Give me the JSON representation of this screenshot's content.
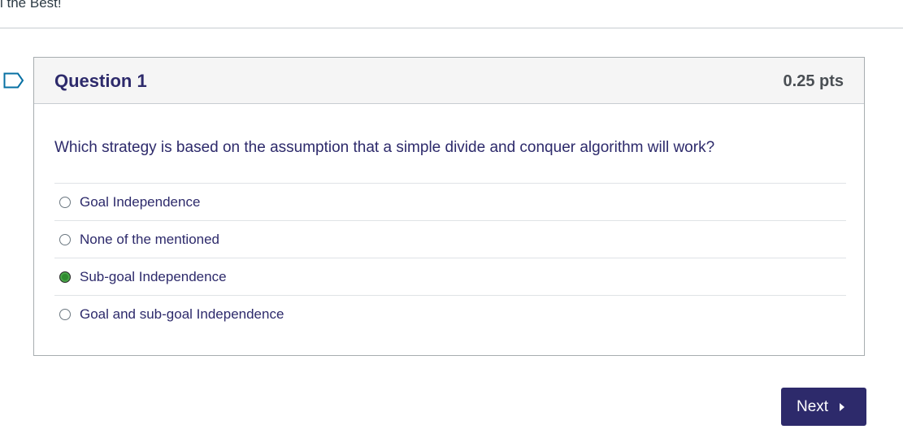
{
  "page": {
    "top_text": "l the Best!"
  },
  "question": {
    "title": "Question 1",
    "points": "0.25 pts",
    "text": "Which strategy is based on the assumption that a simple divide and conquer algorithm will work?",
    "answers": [
      {
        "label": "Goal Independence",
        "selected": false
      },
      {
        "label": "None of the mentioned",
        "selected": false
      },
      {
        "label": "Sub-goal Independence",
        "selected": true
      },
      {
        "label": "Goal and sub-goal Independence",
        "selected": false
      }
    ]
  },
  "navigation": {
    "next_label": "Next"
  },
  "icons": {
    "flag": "bookmark-flag-icon",
    "next_arrow": "caret-right-icon"
  },
  "colors": {
    "accent": "#2d2a6b",
    "selected_radio": "#2e8b2e",
    "flag": "#0770a3"
  }
}
